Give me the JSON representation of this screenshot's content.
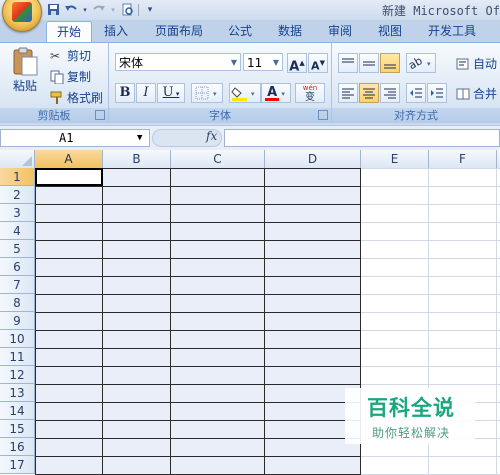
{
  "window": {
    "title": "新建 Microsoft Of"
  },
  "quick_access": {
    "items": [
      "save-icon",
      "undo-icon",
      "redo-icon",
      "print-preview-icon",
      "customize-icon"
    ]
  },
  "tabs": [
    {
      "label": "开始",
      "active": true
    },
    {
      "label": "插入"
    },
    {
      "label": "页面布局"
    },
    {
      "label": "公式"
    },
    {
      "label": "数据"
    },
    {
      "label": "审阅"
    },
    {
      "label": "视图"
    },
    {
      "label": "开发工具"
    }
  ],
  "clipboard": {
    "paste_label": "粘贴",
    "cut_label": "剪切",
    "copy_label": "复制",
    "format_painter_label": "格式刷",
    "group_label": "剪贴板"
  },
  "font": {
    "font_name": "宋体",
    "font_size": "11",
    "bold": "B",
    "italic": "I",
    "underline": "U",
    "grow": "A",
    "shrink": "A",
    "font_color_letter": "A",
    "phonetic": "wén",
    "phonetic_char": "变",
    "group_label": "字体"
  },
  "alignment": {
    "wrap_label": "自动",
    "merge_label": "合并",
    "group_label": "对齐方式"
  },
  "formula_bar": {
    "name_box": "A1",
    "fx": "fx",
    "formula": ""
  },
  "sheet": {
    "columns": [
      "A",
      "B",
      "C",
      "D",
      "E",
      "F"
    ],
    "rows": [
      "1",
      "2",
      "3",
      "4",
      "5",
      "6",
      "7",
      "8",
      "9",
      "10",
      "11",
      "12",
      "13",
      "14",
      "15",
      "16",
      "17"
    ],
    "selected_cell": "A1"
  },
  "watermark": {
    "title": "百科全说",
    "subtitle": "助你轻松解决"
  },
  "colors": {
    "accent": "#15428b",
    "selected_header": "#f1c15f",
    "fill_color": "#ffe600",
    "font_color": "#ff0000",
    "watermark": "#1ba77e"
  }
}
